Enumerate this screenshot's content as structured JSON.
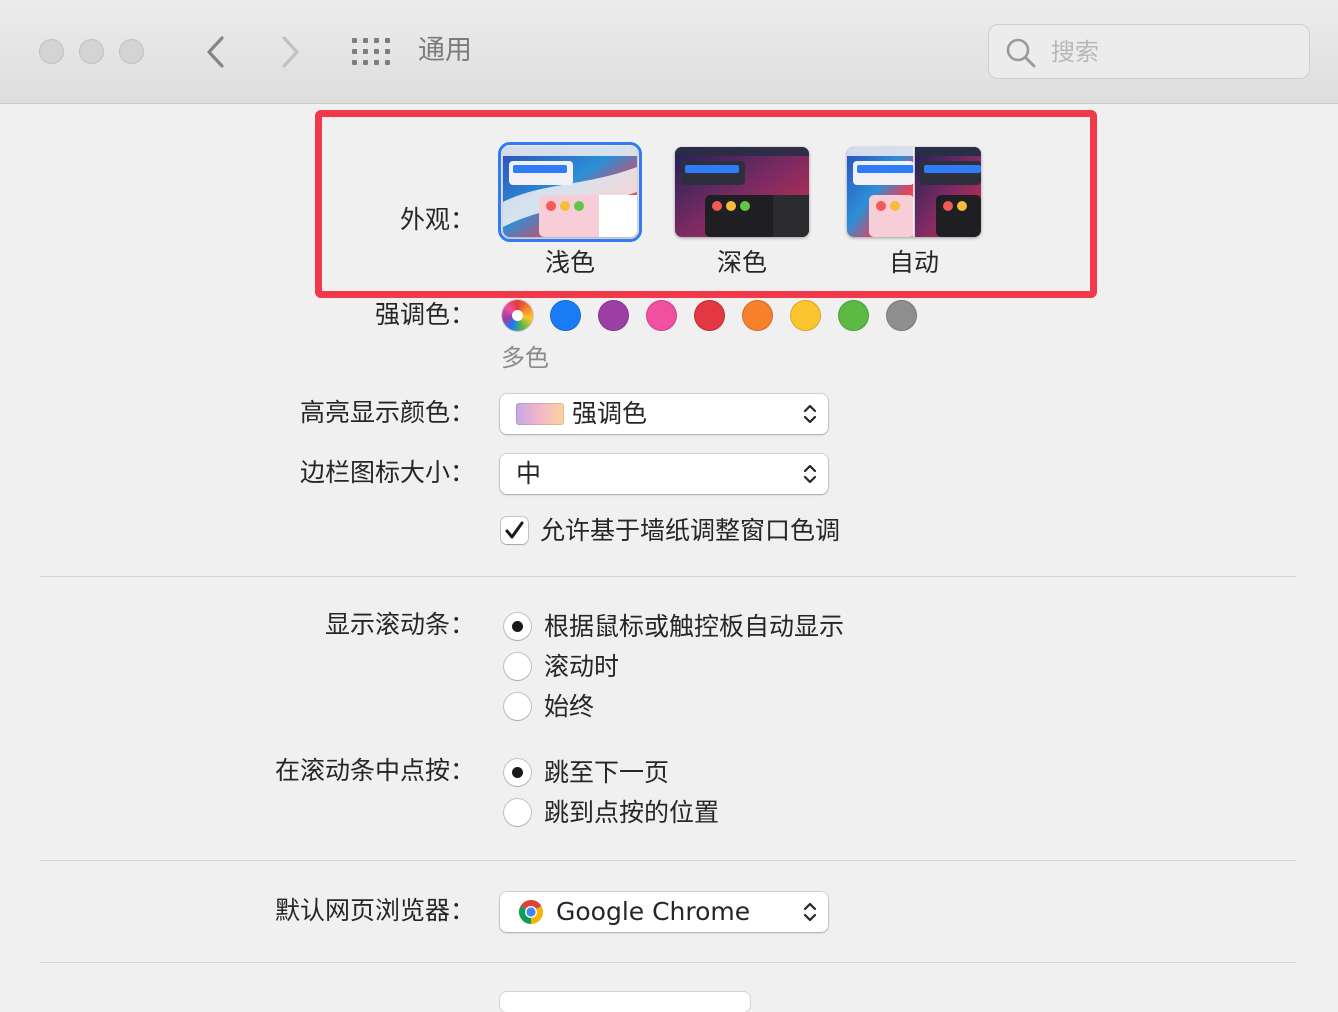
{
  "window": {
    "title": "通用"
  },
  "search": {
    "placeholder": "搜索"
  },
  "appearance": {
    "label": "外观：",
    "options": [
      {
        "label": "浅色",
        "selected": true
      },
      {
        "label": "深色",
        "selected": false
      },
      {
        "label": "自动",
        "selected": false
      }
    ]
  },
  "accent": {
    "label": "强调色：",
    "selected_name": "多色",
    "colors": [
      "multicolor",
      "#1a7cf5",
      "#9b3fa4",
      "#f0509f",
      "#e33741",
      "#f6812a",
      "#fbc52f",
      "#5bb944",
      "#8e8e8e"
    ]
  },
  "highlight": {
    "label": "高亮显示颜色：",
    "value": "强调色"
  },
  "sidebar_icon": {
    "label": "边栏图标大小：",
    "value": "中"
  },
  "tinting": {
    "label": "允许基于墙纸调整窗口色调",
    "checked": true
  },
  "scrollbars": {
    "label": "显示滚动条：",
    "options": [
      {
        "label": "根据鼠标或触控板自动显示",
        "selected": true
      },
      {
        "label": "滚动时",
        "selected": false
      },
      {
        "label": "始终",
        "selected": false
      }
    ]
  },
  "click_scrollbar": {
    "label": "在滚动条中点按：",
    "options": [
      {
        "label": "跳至下一页",
        "selected": true
      },
      {
        "label": "跳到点按的位置",
        "selected": false
      }
    ]
  },
  "browser": {
    "label": "默认网页浏览器：",
    "value": "Google Chrome"
  }
}
